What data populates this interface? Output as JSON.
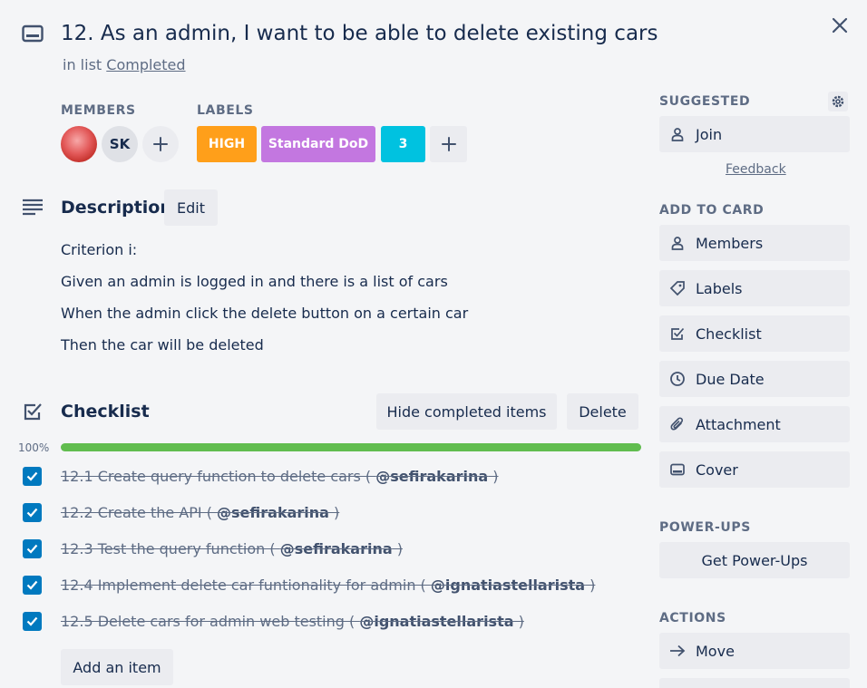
{
  "card": {
    "title": "12. As an admin, I want to be able to delete existing cars",
    "in_list_prefix": "in list",
    "list_name": "Completed"
  },
  "members": {
    "heading": "MEMBERS",
    "avatars": [
      {
        "initials": ""
      },
      {
        "initials": "SK"
      }
    ]
  },
  "labels": {
    "heading": "LABELS",
    "items": [
      {
        "text": "HIGH",
        "color": "#ff9f1a"
      },
      {
        "text": "Standard DoD",
        "color": "#c377e0"
      },
      {
        "text": "3",
        "color": "#00c2e0"
      }
    ]
  },
  "description": {
    "heading": "Description",
    "edit_label": "Edit",
    "lines": [
      "Criterion i:",
      "Given an admin is logged in and there is a list of cars",
      "When the admin click the delete button on a certain car",
      "Then the car will be deleted"
    ]
  },
  "checklist": {
    "heading": "Checklist",
    "hide_label": "Hide completed items",
    "delete_label": "Delete",
    "percent_label": "100%",
    "progress": 1.0,
    "items": [
      {
        "text": "12.1 Create query function to delete cars ( ",
        "mention": "@sefirakarina",
        "suffix": " )",
        "checked": true
      },
      {
        "text": "12.2 Create the API ( ",
        "mention": "@sefirakarina",
        "suffix": " )",
        "checked": true
      },
      {
        "text": "12.3 Test the query function ( ",
        "mention": "@sefirakarina",
        "suffix": " )",
        "checked": true
      },
      {
        "text": "12.4 Implement delete car funtionality for admin ( ",
        "mention": "@ignatiastellarista",
        "suffix": " )",
        "checked": true
      },
      {
        "text": "12.5 Delete cars for admin web testing ( ",
        "mention": "@ignatiastellarista",
        "suffix": " )",
        "checked": true
      }
    ],
    "add_item_label": "Add an item"
  },
  "sidebar": {
    "suggested_heading": "SUGGESTED",
    "join_label": "Join",
    "feedback_label": "Feedback",
    "add_to_card_heading": "ADD TO CARD",
    "add_to_card": [
      {
        "label": "Members",
        "icon": "person-icon"
      },
      {
        "label": "Labels",
        "icon": "tag-icon"
      },
      {
        "label": "Checklist",
        "icon": "checklist-icon"
      },
      {
        "label": "Due Date",
        "icon": "clock-icon"
      },
      {
        "label": "Attachment",
        "icon": "paperclip-icon"
      },
      {
        "label": "Cover",
        "icon": "cover-icon"
      }
    ],
    "power_ups_heading": "POWER-UPS",
    "get_power_ups_label": "Get Power-Ups",
    "actions_heading": "ACTIONS",
    "move_label": "Move"
  },
  "colors": {
    "background": "#f4f5f7",
    "checkbox": "#0079bf",
    "progress": "#61bd4f",
    "button": "#ebecf0"
  }
}
